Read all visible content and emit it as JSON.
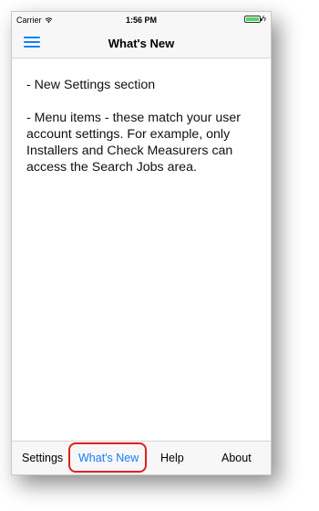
{
  "status_bar": {
    "carrier": "Carrier",
    "time": "1:56 PM",
    "battery_level": 0.9,
    "battery_color": "#4cd964"
  },
  "nav": {
    "title": "What's New",
    "menu_icon": "hamburger-menu-icon",
    "accent_color": "#157efb"
  },
  "content": {
    "paragraphs": [
      "- New Settings section",
      "- Menu items - these match your user account settings. For example, only Installers and Check Measurers can access the Search Jobs area."
    ]
  },
  "tabs": [
    {
      "label": "Settings",
      "active": false
    },
    {
      "label": "What's New",
      "active": true
    },
    {
      "label": "Help",
      "active": false
    },
    {
      "label": "About",
      "active": false
    }
  ],
  "highlight_color": "#e02020"
}
